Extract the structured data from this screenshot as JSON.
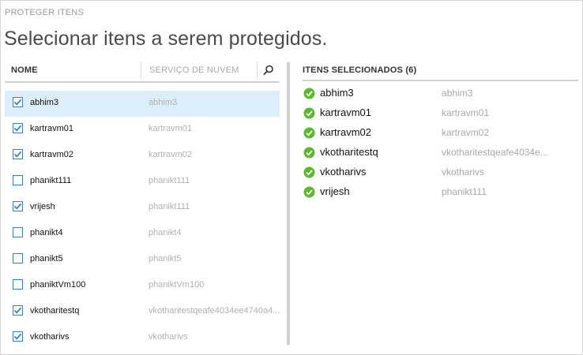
{
  "dialog": {
    "small_title": "PROTEGER ITENS",
    "title": "Selecionar itens a serem protegidos."
  },
  "left_panel": {
    "col_name": "NOME",
    "col_cloud": "SERVIÇO DE NUVEM",
    "search_icon": "search-icon",
    "rows": [
      {
        "name": "abhim3",
        "cloud": "abhim3",
        "checked": true,
        "selected": true
      },
      {
        "name": "kartravm01",
        "cloud": "kartravm01",
        "checked": true,
        "selected": false
      },
      {
        "name": "kartravm02",
        "cloud": "kartravm02",
        "checked": true,
        "selected": false
      },
      {
        "name": "phanikt111",
        "cloud": "phanikt111",
        "checked": false,
        "selected": false
      },
      {
        "name": "vrijesh",
        "cloud": "phanikt111",
        "checked": true,
        "selected": false
      },
      {
        "name": "phanikt4",
        "cloud": "phanikt4",
        "checked": false,
        "selected": false
      },
      {
        "name": "phanikt5",
        "cloud": "phanikt5",
        "checked": false,
        "selected": false
      },
      {
        "name": "phaniktVm100",
        "cloud": "phaniktVm100",
        "checked": false,
        "selected": false
      },
      {
        "name": "vkotharitestq",
        "cloud": "vkotharitestqeafe4034ee4740a4...",
        "checked": true,
        "selected": false
      },
      {
        "name": "vkotharivs",
        "cloud": "vkotharivs",
        "checked": true,
        "selected": false
      }
    ]
  },
  "right_panel": {
    "header": "ITENS SELECIONADOS (6)",
    "items": [
      {
        "name": "abhim3",
        "cloud": "abhim3"
      },
      {
        "name": "kartravm01",
        "cloud": "kartravm01"
      },
      {
        "name": "kartravm02",
        "cloud": "kartravm02"
      },
      {
        "name": "vkotharitestq",
        "cloud": "vkotharitestqeafe4034e..."
      },
      {
        "name": "vkotharivs",
        "cloud": "vkotharivs"
      },
      {
        "name": "vrijesh",
        "cloud": "phanikt111"
      }
    ]
  },
  "colors": {
    "checkbox": "#3e7fbf",
    "selected_row": "#dbeefa",
    "check_green": "#5cb82e"
  }
}
